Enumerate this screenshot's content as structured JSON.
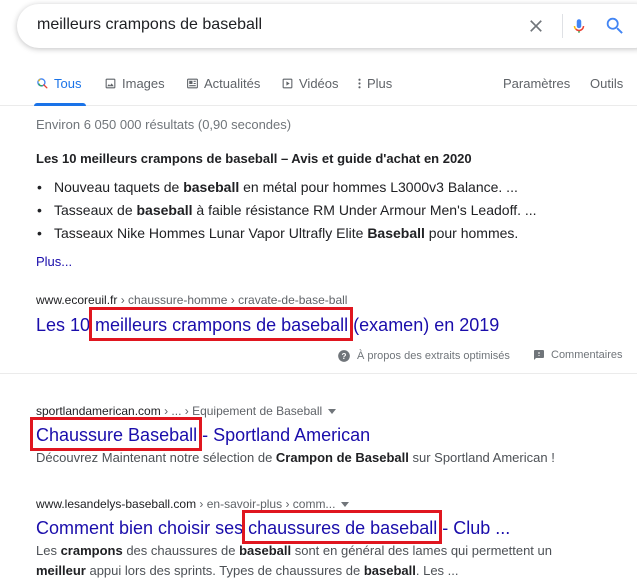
{
  "search": {
    "query": "meilleurs crampons de baseball"
  },
  "tabs": [
    {
      "label": "Tous",
      "icon": "search-icon"
    },
    {
      "label": "Images",
      "icon": "image-icon"
    },
    {
      "label": "Actualités",
      "icon": "news-icon"
    },
    {
      "label": "Vidéos",
      "icon": "video-icon"
    },
    {
      "label": "Plus",
      "icon": "more-vert-icon"
    }
  ],
  "settings_label": "Paramètres",
  "tools_label": "Outils",
  "stats": "Environ 6 050 000 résultats (0,90 secondes)",
  "featured": {
    "title": "Les 10 meilleurs crampons de baseball – Avis et guide d'achat en 2020",
    "bullets": [
      {
        "pre": "Nouveau taquets de ",
        "bold": "baseball",
        "post": " en métal pour hommes L3000v3 Balance. ..."
      },
      {
        "pre": "Tasseaux de ",
        "bold": "baseball",
        "post": " à faible résistance RM Under Armour Men's Leadoff. ..."
      },
      {
        "pre": "Tasseaux Nike Hommes Lunar Vapor Ultrafly Elite ",
        "bold": "Baseball",
        "post": " pour hommes."
      }
    ],
    "more": "Plus...",
    "cite_domain": "www.ecoreuil.fr",
    "cite_path": " › chaussure-homme › cravate-de-base-ball",
    "title_link_pre": "Les 10 ",
    "title_link_hl": "meilleurs crampons de baseball",
    "title_link_post": " (examen) en 2019",
    "about_label": "À propos des extraits optimisés",
    "feedback_label": "Commentaires"
  },
  "results": [
    {
      "cite_domain": "sportlandamerican.com",
      "cite_path": " › ... › Equipement de Baseball",
      "title_hl": "Chaussure Baseball",
      "title_post": " - Sportland American",
      "desc_1": "Découvrez Maintenant notre sélection de ",
      "desc_bold_1": "Crampon de Baseball",
      "desc_2": " sur Sportland American !"
    },
    {
      "cite_domain": "www.lesandelys-baseball.com",
      "cite_path": " › en-savoir-plus › comm...",
      "title_pre": "Comment bien choisir ses ",
      "title_hl": "chaussures de baseball",
      "title_post": " - Club ...",
      "desc_a": "Les ",
      "desc_b": "crampons",
      "desc_c": " des chaussures de ",
      "desc_d": "baseball",
      "desc_e": " sont en général des lames qui permettent un",
      "desc_f": "meilleur",
      "desc_g": " appui lors des sprints. Types de chaussures de ",
      "desc_h": "baseball",
      "desc_i": ". Les ..."
    }
  ],
  "colors": {
    "link": "#1a0dab",
    "accent": "#1a73e8",
    "highlight_box": "#e0161f"
  }
}
